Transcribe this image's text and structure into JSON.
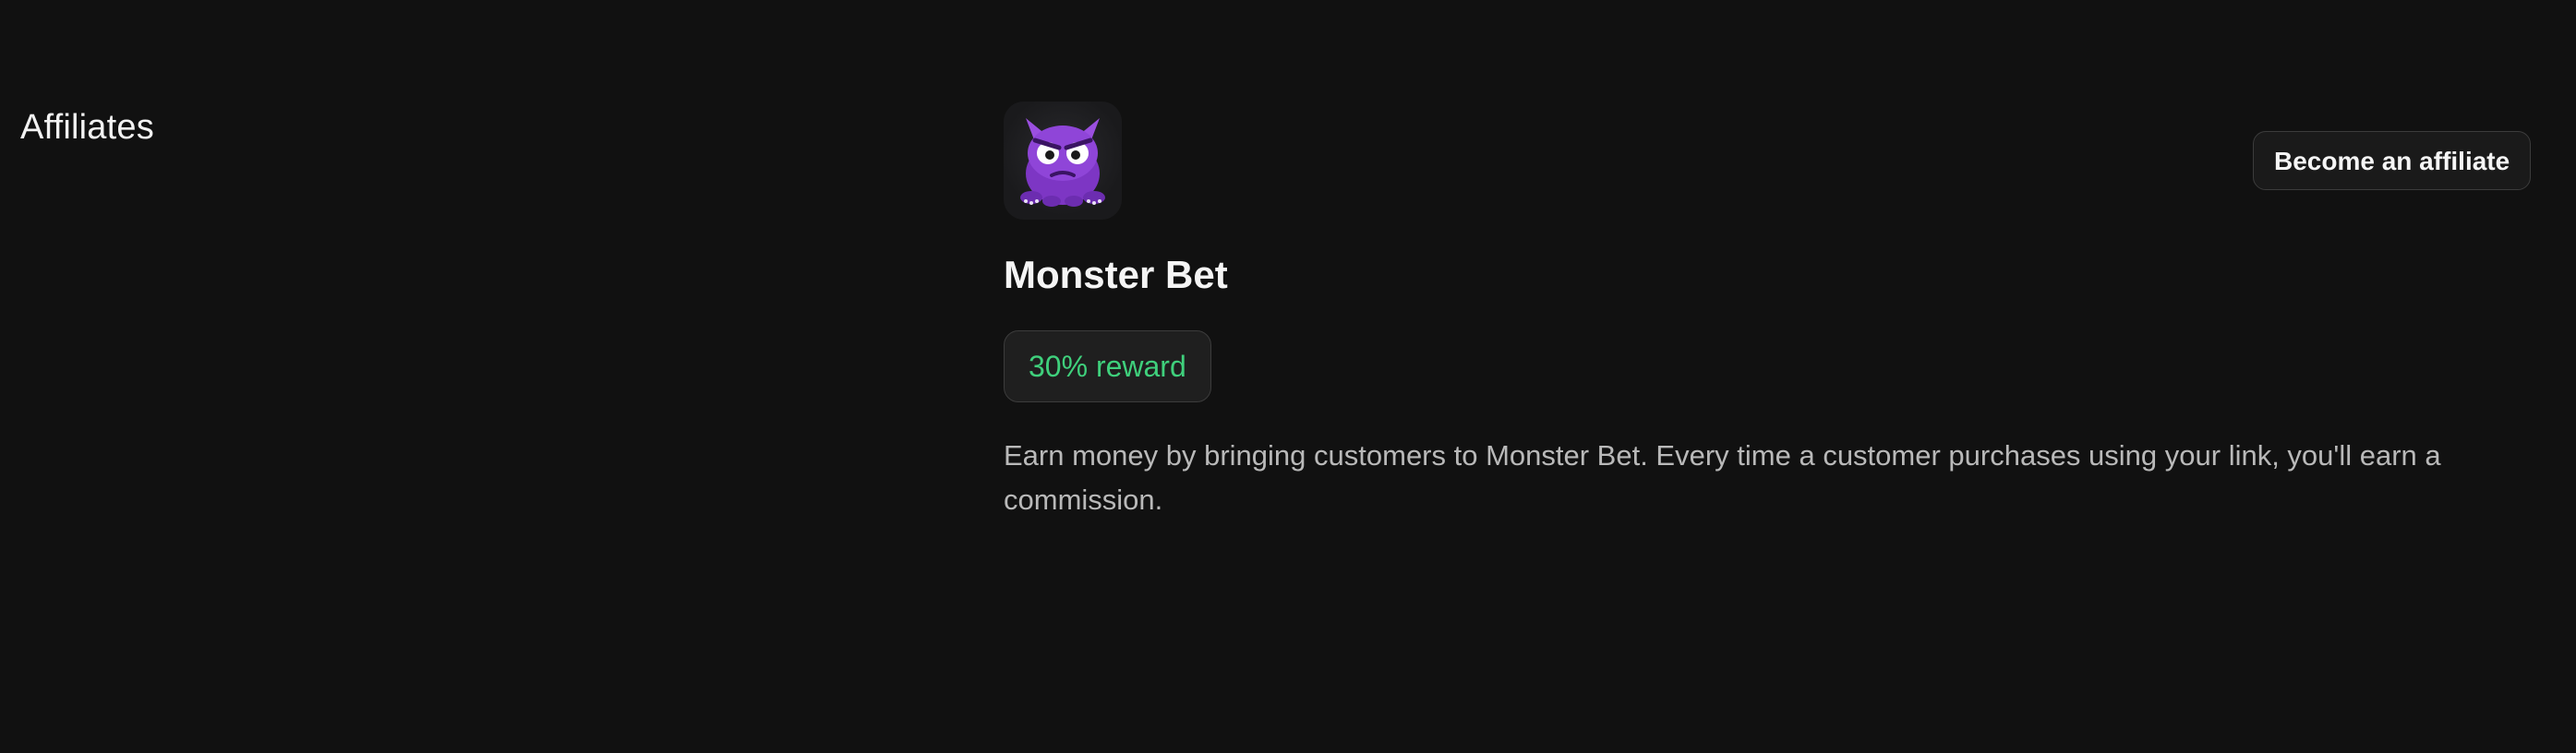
{
  "page": {
    "title": "Affiliates"
  },
  "affiliate": {
    "logo_icon": "purple-monster-icon",
    "name": "Monster Bet",
    "reward_label": "30% reward",
    "description": "Earn money by bringing customers to Monster Bet. Every time a customer purchases using your link, you'll earn a commission."
  },
  "actions": {
    "become_affiliate_label": "Become an affiliate"
  },
  "colors": {
    "background": "#111111",
    "reward_accent": "#3fd07c",
    "monster_purple": "#8a3fd1"
  }
}
